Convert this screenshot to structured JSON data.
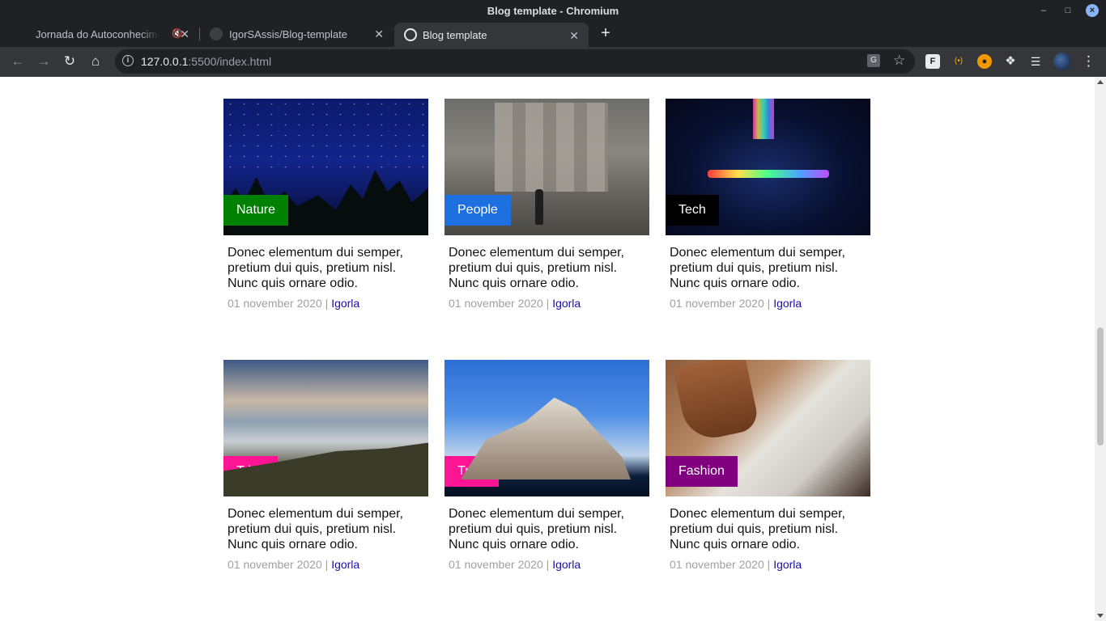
{
  "window": {
    "title": "Blog template - Chromium"
  },
  "tabs": [
    {
      "label": "Jornada do Autoconhecimento"
    },
    {
      "label": "IgorSAssis/Blog-template"
    },
    {
      "label": "Blog template"
    }
  ],
  "toolbar": {
    "url_host": "127.0.0.1",
    "url_rest": ":5500/index.html"
  },
  "icons": {
    "back": "back-arrow-icon",
    "forward": "forward-arrow-icon",
    "reload": "reload-icon",
    "home": "home-icon",
    "info": "info-icon",
    "translate": "translate-icon",
    "star": "bookmark-star-icon",
    "extensions": "puzzle-icon",
    "menu": "kebab-menu-icon"
  },
  "colors": {
    "nature": "#008000",
    "people": "#1e6fe0",
    "tech": "#000000",
    "trips": "#ff1493",
    "fashion": "#800080",
    "author_link": "#1a0dab"
  },
  "posts": [
    {
      "category": "Nature",
      "excerpt": "Donec elementum dui semper, pretium dui quis, pretium nisl. Nunc quis ornare odio.",
      "date": "01 november 2020",
      "author": "Igorla"
    },
    {
      "category": "People",
      "excerpt": "Donec elementum dui semper, pretium dui quis, pretium nisl. Nunc quis ornare odio.",
      "date": "01 november 2020",
      "author": "Igorla"
    },
    {
      "category": "Tech",
      "excerpt": "Donec elementum dui semper, pretium dui quis, pretium nisl. Nunc quis ornare odio.",
      "date": "01 november 2020",
      "author": "Igorla"
    },
    {
      "category": "Trips",
      "excerpt": "Donec elementum dui semper, pretium dui quis, pretium nisl. Nunc quis ornare odio.",
      "date": "01 november 2020",
      "author": "Igorla"
    },
    {
      "category": "Trips",
      "excerpt": "Donec elementum dui semper, pretium dui quis, pretium nisl. Nunc quis ornare odio.",
      "date": "01 november 2020",
      "author": "Igorla"
    },
    {
      "category": "Fashion",
      "excerpt": "Donec elementum dui semper, pretium dui quis, pretium nisl. Nunc quis ornare odio.",
      "date": "01 november 2020",
      "author": "Igorla"
    }
  ]
}
